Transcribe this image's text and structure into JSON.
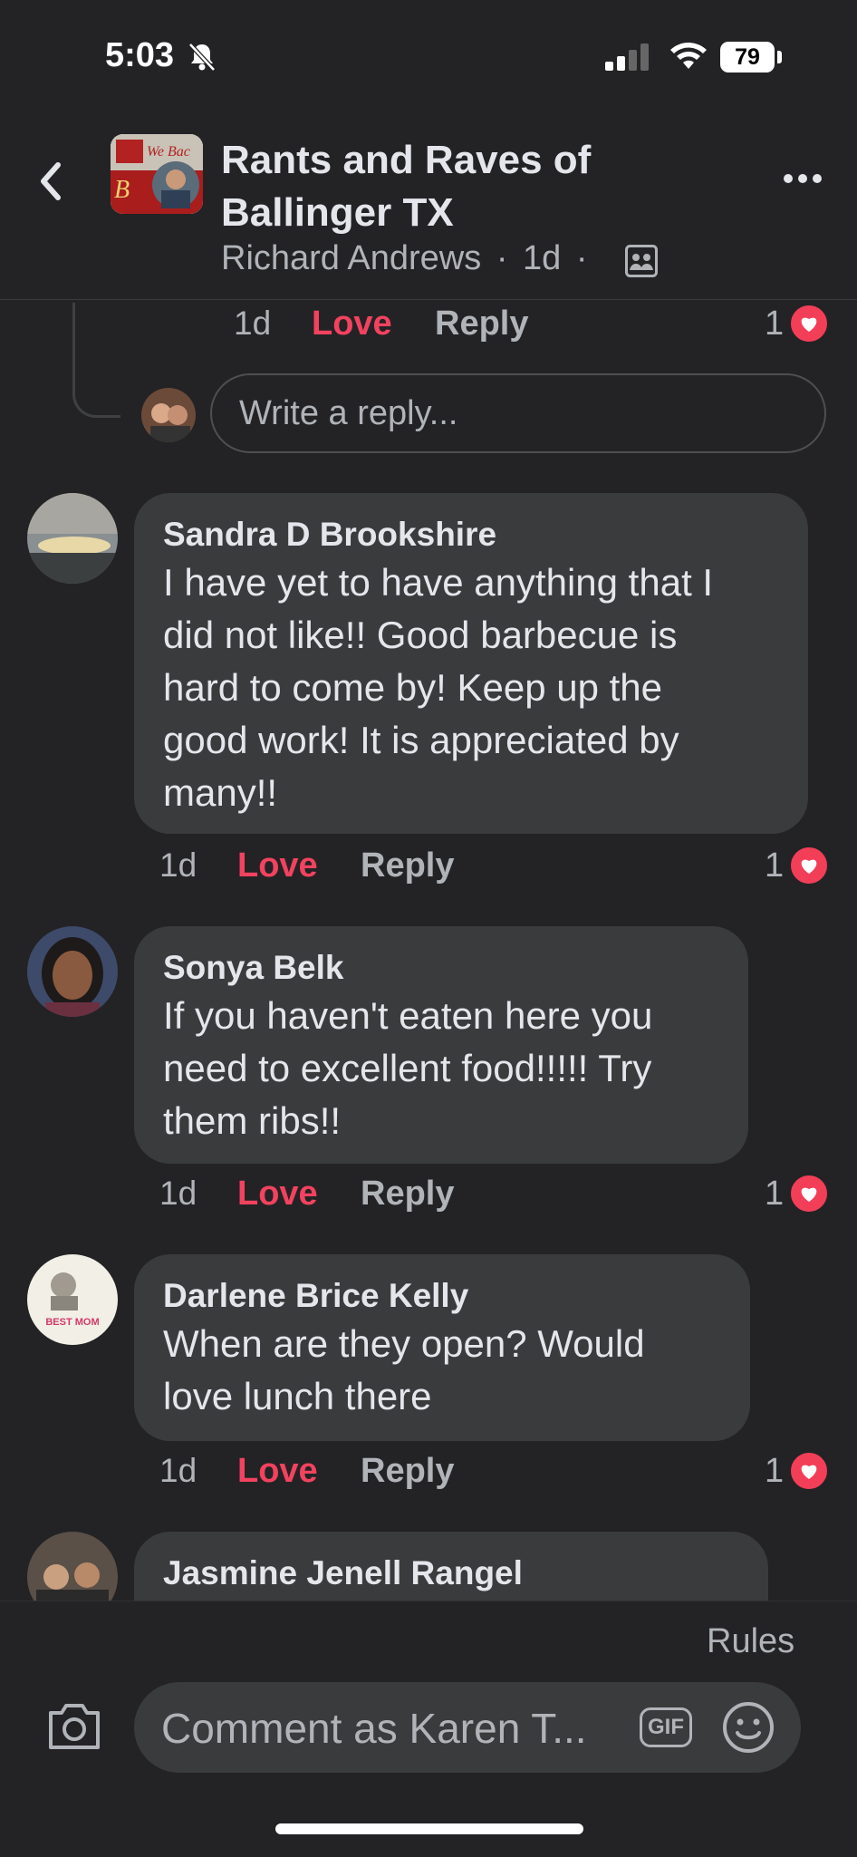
{
  "status_bar": {
    "time": "5:03",
    "battery": "79"
  },
  "header": {
    "title": "Rants and Raves of Ballinger TX",
    "author": "Richard Andrews",
    "separator": "·",
    "time": "1d",
    "separator2": "·",
    "thumb_text": "We Bac"
  },
  "previous_meta": {
    "time": "1d",
    "love": "Love",
    "reply": "Reply",
    "count": "1"
  },
  "reply_input": {
    "placeholder": "Write a reply..."
  },
  "comments": [
    {
      "author": "Sandra D Brookshire",
      "text": "I have yet to have anything that I\ndid not like!!  Good barbecue is\nhard to come by!  Keep up the\ngood work! It is appreciated by\nmany!!",
      "time": "1d",
      "love": "Love",
      "reply": "Reply",
      "count": "1"
    },
    {
      "author": "Sonya Belk",
      "text": "If you haven't eaten here you\nneed to excellent food!!!!! Try\nthem ribs!!",
      "time": "1d",
      "love": "Love",
      "reply": "Reply",
      "count": "1"
    },
    {
      "author": "Darlene Brice Kelly",
      "text": "When are they open?   Would\nlove lunch there",
      "time": "1d",
      "love": "Love",
      "reply": "Reply",
      "count": "1",
      "avatar_text": "BEST MOM"
    },
    {
      "author": "Jasmine Jenell Rangel"
    }
  ],
  "composer": {
    "rules": "Rules",
    "placeholder": "Comment as Karen T...",
    "gif": "GIF"
  },
  "colors": {
    "background": "#232325",
    "bubble": "#3a3b3c",
    "love": "#f3425f",
    "muted": "#b0b3b8"
  },
  "icons": [
    "bell-slash-icon",
    "signal-icon",
    "wifi-icon",
    "back-chevron-icon",
    "more-icon",
    "group-members-icon",
    "heart-icon",
    "camera-icon",
    "emoji-icon"
  ]
}
